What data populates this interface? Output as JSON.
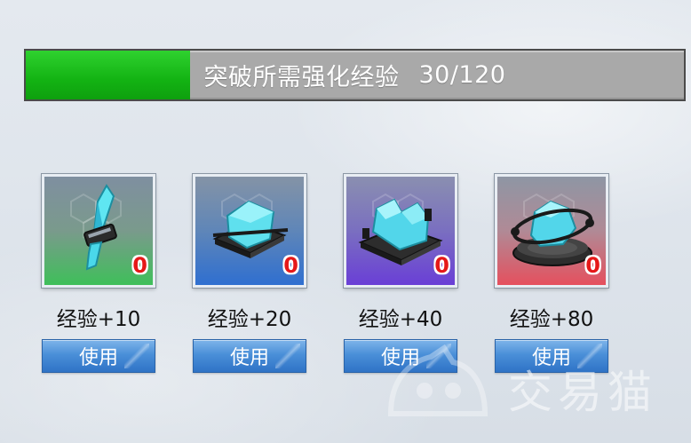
{
  "progress": {
    "label": "突破所需强化经验",
    "value": "30/120",
    "current": 30,
    "max": 120,
    "fill_color": "#13b313"
  },
  "items": [
    {
      "exp_label": "经验+10",
      "count": "0",
      "use_label": "使用",
      "rarity": "green",
      "icon": "crystal-shard-icon"
    },
    {
      "exp_label": "经验+20",
      "count": "0",
      "use_label": "使用",
      "rarity": "blue",
      "icon": "crystal-block-icon"
    },
    {
      "exp_label": "经验+40",
      "count": "0",
      "use_label": "使用",
      "rarity": "purple",
      "icon": "crystal-cluster-icon"
    },
    {
      "exp_label": "经验+80",
      "count": "0",
      "use_label": "使用",
      "rarity": "red",
      "icon": "crystal-core-icon"
    }
  ],
  "watermark": {
    "text": "交易猫"
  }
}
